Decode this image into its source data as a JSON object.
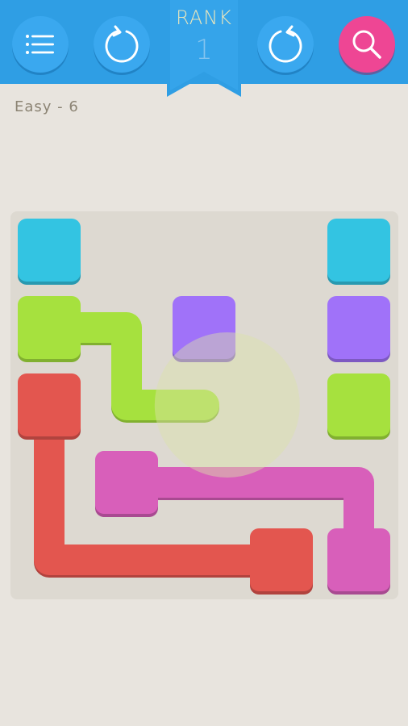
{
  "toolbar": {
    "menu_icon": "menu-icon",
    "undo_icon": "undo-icon",
    "restart_icon": "restart-icon",
    "hint_icon": "search-icon",
    "colors": {
      "bar": "#2f9ee4",
      "button": "#3aa8ef",
      "hint_button": "#ee4694"
    }
  },
  "rank": {
    "label": "RANK",
    "value": "1"
  },
  "level": {
    "label": "Easy - 6"
  },
  "board": {
    "grid_size": 5,
    "colors": {
      "cyan": "#33c4e2",
      "purple": "#a072f9",
      "green": "#a6e13e",
      "red": "#e3564f",
      "pink": "#d85fba"
    },
    "endpoints": [
      {
        "color": "cyan",
        "row": 0,
        "col": 0
      },
      {
        "color": "cyan",
        "row": 0,
        "col": 4
      },
      {
        "color": "green",
        "row": 1,
        "col": 0
      },
      {
        "color": "purple",
        "row": 1,
        "col": 2
      },
      {
        "color": "purple",
        "row": 1,
        "col": 4
      },
      {
        "color": "green",
        "row": 2,
        "col": 4
      },
      {
        "color": "red",
        "row": 2,
        "col": 0
      },
      {
        "color": "pink",
        "row": 3,
        "col": 1
      },
      {
        "color": "red",
        "row": 4,
        "col": 3
      },
      {
        "color": "pink",
        "row": 4,
        "col": 4
      }
    ],
    "paths": [
      {
        "color": "green",
        "cells": [
          [
            1,
            0
          ],
          [
            1,
            1
          ],
          [
            2,
            1
          ],
          [
            2,
            2
          ]
        ]
      },
      {
        "color": "red",
        "cells": [
          [
            2,
            0
          ],
          [
            3,
            0
          ],
          [
            4,
            0
          ],
          [
            4,
            1
          ],
          [
            4,
            2
          ],
          [
            4,
            3
          ]
        ]
      },
      {
        "color": "pink",
        "cells": [
          [
            3,
            1
          ],
          [
            3,
            2
          ],
          [
            3,
            3
          ],
          [
            3,
            4
          ],
          [
            4,
            4
          ]
        ]
      }
    ],
    "touch_indicator": {
      "row": 2,
      "col": 2.3,
      "color": "#dbe3a8"
    }
  }
}
